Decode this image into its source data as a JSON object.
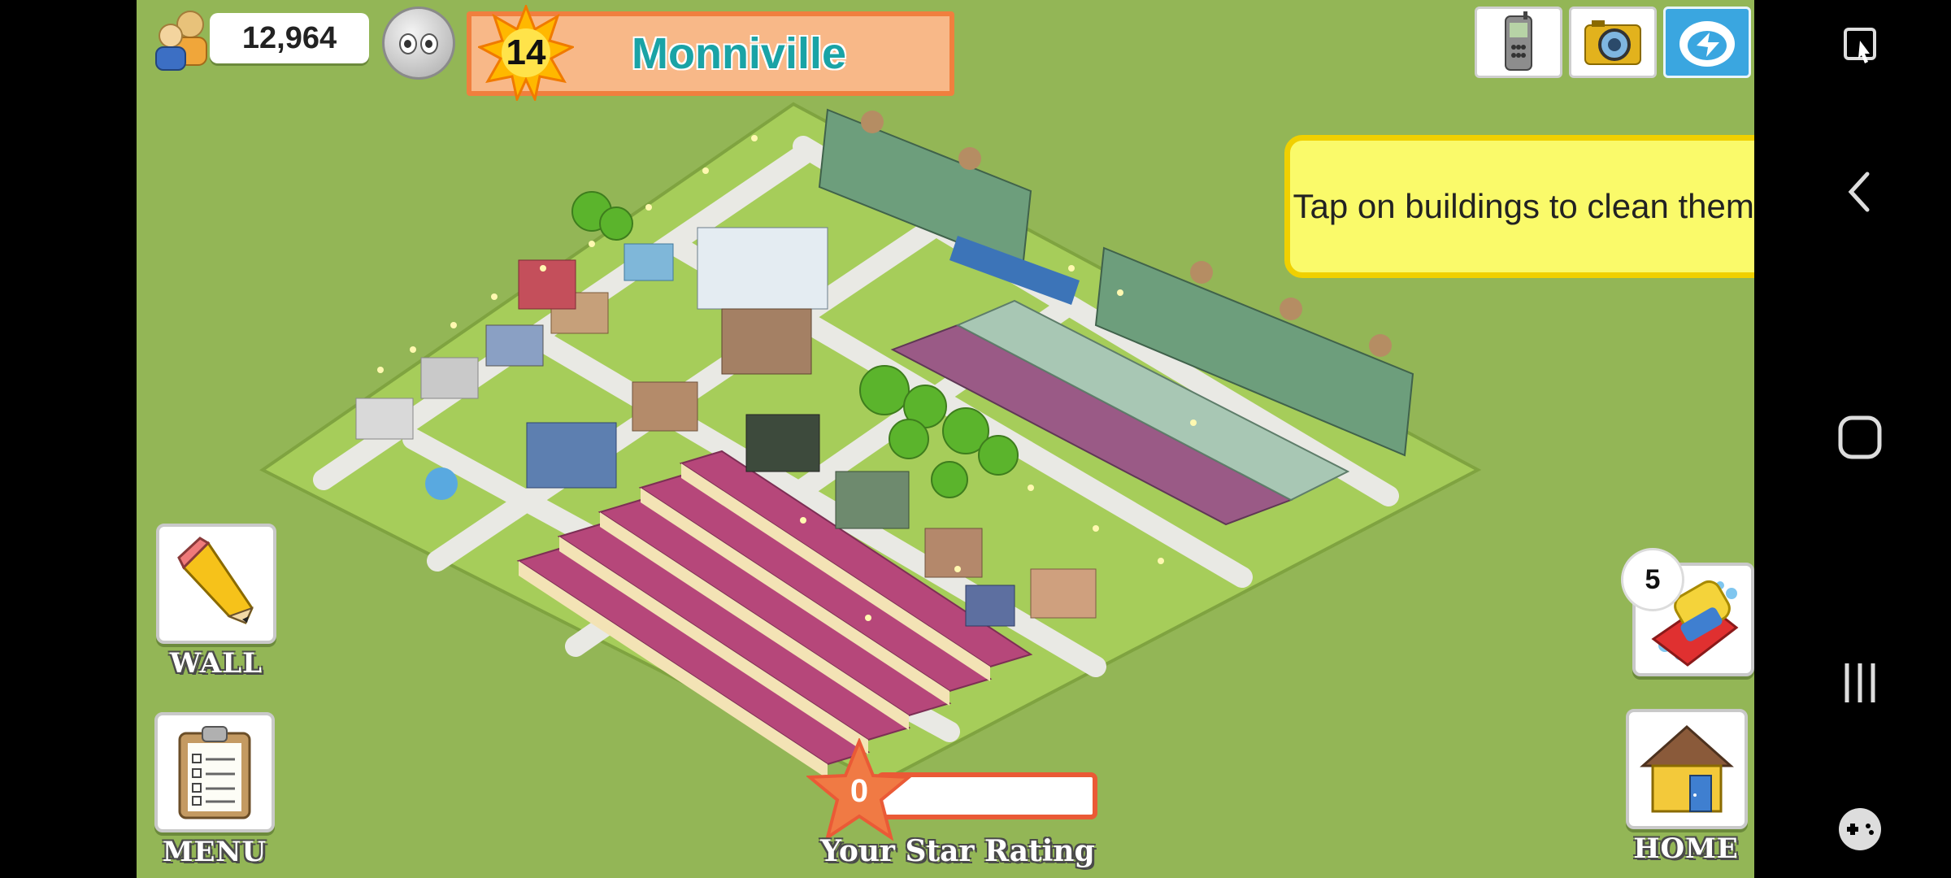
{
  "hud": {
    "population": "12,964",
    "level": "14",
    "city_name": "Monniville"
  },
  "tip": {
    "text": "Tap on buildings to clean them."
  },
  "buttons": {
    "wall_label": "WALL",
    "menu_label": "MENU",
    "home_label": "HOME",
    "clean_count": "5"
  },
  "rating": {
    "value": "0",
    "progress": 0,
    "label": "Your Star Rating"
  },
  "icons": {
    "population": "people-icon",
    "neighbor": "alien-face-icon",
    "phone": "phone-icon",
    "camera": "camera-icon",
    "share": "share-icon",
    "wall": "pencil-icon",
    "menu": "clipboard-icon",
    "home": "house-icon",
    "clean": "sponge-icon"
  },
  "colors": {
    "background": "#93b656",
    "banner_fill": "#f8b888",
    "banner_border": "#f07f3e",
    "city_name": "#1aa3a6",
    "tip_fill": "#fafa6a",
    "rating_border": "#ea5a36"
  }
}
